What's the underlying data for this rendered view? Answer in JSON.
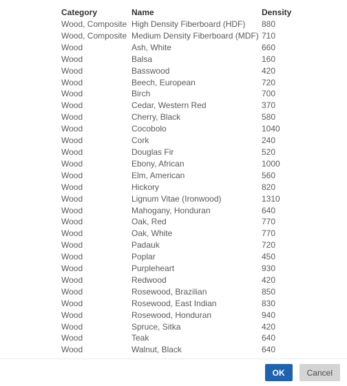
{
  "dialog": {
    "table": {
      "columns": [
        {
          "key": "category",
          "label": "Category"
        },
        {
          "key": "name",
          "label": "Name"
        },
        {
          "key": "density",
          "label": "Density"
        }
      ],
      "rows": [
        {
          "category": "Wood, Composite",
          "name": "High Density Fiberboard (HDF)",
          "density": "880"
        },
        {
          "category": "Wood, Composite",
          "name": "Medium Density Fiberboard (MDF)",
          "density": "710"
        },
        {
          "category": "Wood",
          "name": "Ash, White",
          "density": "660"
        },
        {
          "category": "Wood",
          "name": "Balsa",
          "density": "160"
        },
        {
          "category": "Wood",
          "name": "Basswood",
          "density": "420"
        },
        {
          "category": "Wood",
          "name": "Beech, European",
          "density": "720"
        },
        {
          "category": "Wood",
          "name": "Birch",
          "density": "700"
        },
        {
          "category": "Wood",
          "name": "Cedar, Western Red",
          "density": "370"
        },
        {
          "category": "Wood",
          "name": "Cherry, Black",
          "density": "580"
        },
        {
          "category": "Wood",
          "name": "Cocobolo",
          "density": "1040"
        },
        {
          "category": "Wood",
          "name": "Cork",
          "density": "240"
        },
        {
          "category": "Wood",
          "name": "Douglas Fir",
          "density": "520"
        },
        {
          "category": "Wood",
          "name": "Ebony, African",
          "density": "1000"
        },
        {
          "category": "Wood",
          "name": "Elm, American",
          "density": "560"
        },
        {
          "category": "Wood",
          "name": "Hickory",
          "density": "820"
        },
        {
          "category": "Wood",
          "name": "Lignum Vitae (Ironwood)",
          "density": "1310"
        },
        {
          "category": "Wood",
          "name": "Mahogany, Honduran",
          "density": "640"
        },
        {
          "category": "Wood",
          "name": "Oak, Red",
          "density": "770"
        },
        {
          "category": "Wood",
          "name": "Oak, White",
          "density": "770"
        },
        {
          "category": "Wood",
          "name": "Padauk",
          "density": "720"
        },
        {
          "category": "Wood",
          "name": "Poplar",
          "density": "450"
        },
        {
          "category": "Wood",
          "name": "Purpleheart",
          "density": "930"
        },
        {
          "category": "Wood",
          "name": "Redwood",
          "density": "420"
        },
        {
          "category": "Wood",
          "name": "Rosewood, Brazilian",
          "density": "850"
        },
        {
          "category": "Wood",
          "name": "Rosewood, East Indian",
          "density": "830"
        },
        {
          "category": "Wood",
          "name": "Rosewood, Honduran",
          "density": "940"
        },
        {
          "category": "Wood",
          "name": "Spruce, Sitka",
          "density": "420"
        },
        {
          "category": "Wood",
          "name": "Teak",
          "density": "640"
        },
        {
          "category": "Wood",
          "name": "Walnut, Black",
          "density": "640"
        }
      ]
    },
    "footer": {
      "ok_label": "OK",
      "cancel_label": "Cancel"
    }
  },
  "colors": {
    "accent": "#1f62b0",
    "cancel_bg": "#d4d4d4",
    "header_text": "#303030",
    "body_text": "#5a5a5a",
    "separator": "#ececec",
    "background": "#ffffff"
  }
}
